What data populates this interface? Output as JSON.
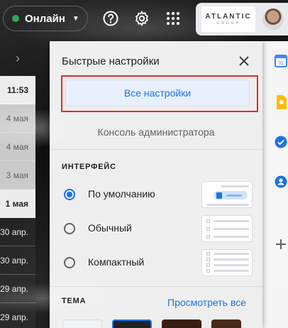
{
  "header": {
    "status_label": "Онлайн",
    "status_color": "#34a853",
    "icons": [
      "help-icon",
      "settings-gear-icon",
      "apps-grid-icon"
    ],
    "account": {
      "logo_text": "ATLANTIC",
      "logo_subtext": "GROUP"
    }
  },
  "mail_list": {
    "rows": [
      {
        "date": "11:53",
        "state": "unread"
      },
      {
        "date": "4 мая",
        "state": "read"
      },
      {
        "date": "4 мая",
        "state": "read"
      },
      {
        "date": "3 мая",
        "state": "read"
      },
      {
        "date": "1 мая",
        "state": "unread"
      },
      {
        "date": "30 апр.",
        "state": "dark"
      },
      {
        "date": "30 апр.",
        "state": "dark"
      },
      {
        "date": "29 апр.",
        "state": "dark"
      },
      {
        "date": "29 апр.",
        "state": "dark"
      }
    ]
  },
  "quick_settings": {
    "title": "Быстрые настройки",
    "all_settings_label": "Все настройки",
    "admin_console_label": "Консоль администратора",
    "interface_heading": "ИНТЕРФЕЙС",
    "density_options": [
      {
        "label": "По умолчанию",
        "selected": true
      },
      {
        "label": "Обычный",
        "selected": false
      },
      {
        "label": "Компактный",
        "selected": false
      }
    ],
    "theme_heading": "ТЕМА",
    "view_all_label": "Просмотреть все",
    "highlight_color": "#e8262d",
    "accent_color": "#1a73e8"
  },
  "side_panel": {
    "apps": [
      "calendar-icon",
      "keep-icon",
      "tasks-icon",
      "contacts-icon",
      "add-icon"
    ]
  }
}
